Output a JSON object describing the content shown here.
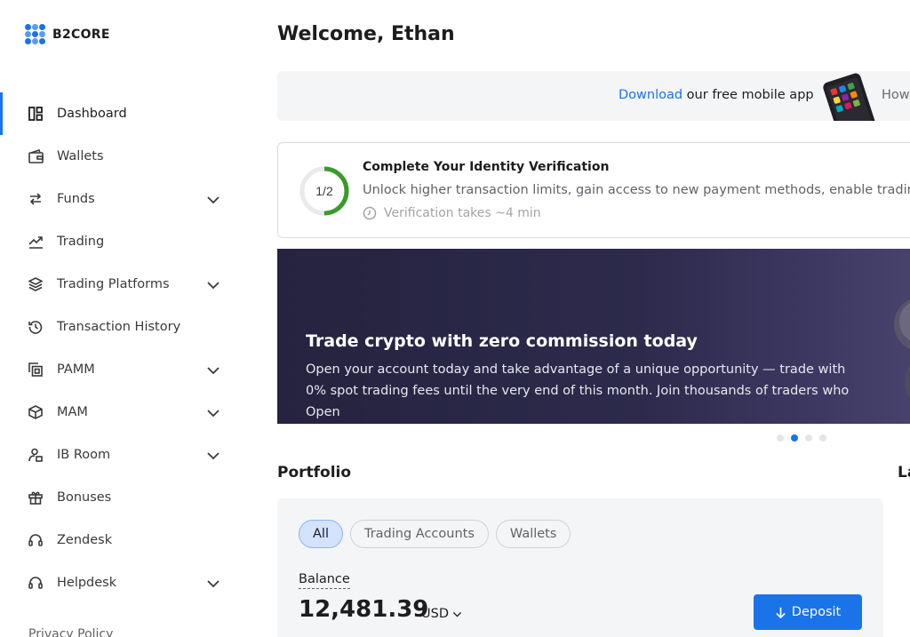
{
  "brand": {
    "name": "B2CORE",
    "accent": "#1a73e8"
  },
  "sidebar": {
    "items": [
      {
        "label": "Dashboard",
        "icon": "dashboard-icon",
        "active": true,
        "expandable": false
      },
      {
        "label": "Wallets",
        "icon": "wallet-icon",
        "expandable": false
      },
      {
        "label": "Funds",
        "icon": "swap-arrows-icon",
        "expandable": true
      },
      {
        "label": "Trading",
        "icon": "trending-up-icon",
        "expandable": false
      },
      {
        "label": "Trading Platforms",
        "icon": "layers-icon",
        "expandable": true
      },
      {
        "label": "Transaction History",
        "icon": "history-icon",
        "expandable": false
      },
      {
        "label": "PAMM",
        "icon": "copy-icon",
        "expandable": true
      },
      {
        "label": "MAM",
        "icon": "box-icon",
        "expandable": true
      },
      {
        "label": "IB Room",
        "icon": "user-network-icon",
        "expandable": true
      },
      {
        "label": "Bonuses",
        "icon": "gift-icon",
        "expandable": false
      },
      {
        "label": "Zendesk",
        "icon": "headset-icon",
        "expandable": false
      },
      {
        "label": "Helpdesk",
        "icon": "headset-icon",
        "expandable": true
      }
    ],
    "privacy": "Privacy Policy"
  },
  "header": {
    "welcome": "Welcome, Ethan"
  },
  "app_banner": {
    "link": "Download",
    "text": " our free mobile app",
    "how": "How"
  },
  "verification": {
    "progress": "1/2",
    "progress_fraction": 0.5,
    "title": "Complete Your Identity Verification",
    "description": "Unlock higher transaction limits, gain access to new payment methods, enable trading ac",
    "time": "Verification takes ~4 min"
  },
  "promo": {
    "title": "Trade crypto with zero commission today",
    "text": "Open your account today and take advantage of a unique opportunity — trade with 0% spot trading fees until the very end of this month. Join thousands of traders who Open",
    "slides": 4,
    "active_slide": 2
  },
  "portfolio": {
    "heading": "Portfolio",
    "side_heading": "La",
    "tabs": [
      "All",
      "Trading Accounts",
      "Wallets"
    ],
    "active_tab": 0,
    "balance_label": "Balance",
    "balance_value": "12,481.39",
    "currency": "USD",
    "deposit_label": "Deposit"
  },
  "colors": {
    "promo_bg": "#2d2a4c",
    "ring": "#3a9b2a",
    "active_chip": "#d3e3fd"
  }
}
